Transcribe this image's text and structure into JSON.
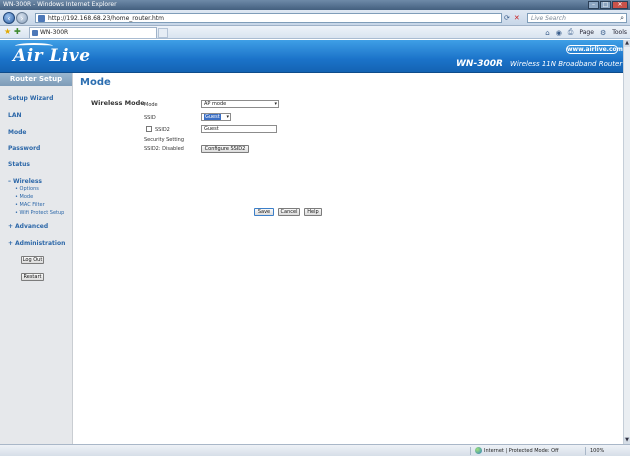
{
  "browser": {
    "window_title": "WN-300R - Windows Internet Explorer",
    "url": "http://192.168.68.23/home_router.htm",
    "search_placeholder": "Live Search",
    "tab_title": "WN-300R",
    "page_menu": "Page",
    "tools_menu": "Tools",
    "status_zone": "Internet | Protected Mode: Off",
    "zoom": "100%"
  },
  "banner": {
    "logo_text": "Air Live",
    "website": "www.airlive.com",
    "model": "WN-300R",
    "tagline": "Wireless 11N Broadband Router"
  },
  "sidebar": {
    "header": "Router Setup",
    "items": [
      {
        "label": "Setup Wizard"
      },
      {
        "label": "LAN"
      },
      {
        "label": "Mode"
      },
      {
        "label": "Password"
      },
      {
        "label": "Status"
      }
    ],
    "wireless": {
      "label": "Wireless",
      "sub": [
        "Options",
        "Mode",
        "MAC Filter",
        "Wifi Protect Setup"
      ]
    },
    "advanced": "Advanced",
    "administration": "Administration",
    "logout_button": "Log Out",
    "restart_button": "Restart"
  },
  "main": {
    "title": "Mode",
    "section": "Wireless Mode",
    "mode_label": "Mode",
    "mode_value": "AP mode",
    "ssid_label": "SSID",
    "ssid_value": "Guest",
    "ssid2_label": "SSID2",
    "ssid2_value": "Guest",
    "security_setting": "Security Setting",
    "ssid2_disabled": "SSID2: Disabled",
    "configure_ssid2": "Configure SSID2",
    "save": "Save",
    "cancel": "Cancel",
    "help": "Help"
  }
}
